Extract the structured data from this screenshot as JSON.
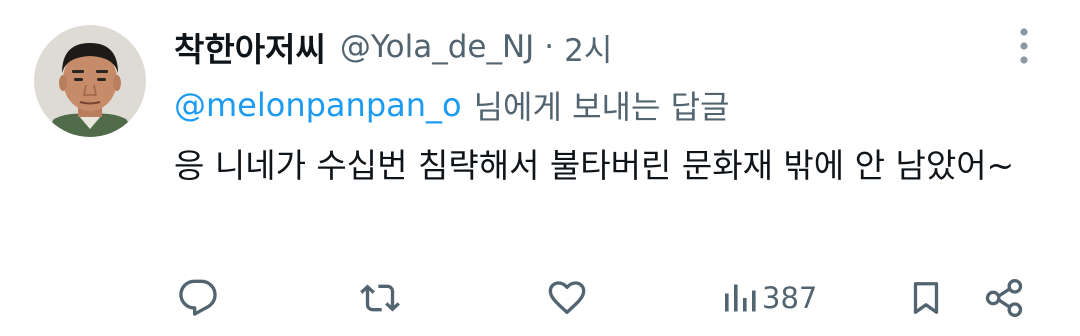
{
  "author": {
    "display_name": "착한아저씨",
    "handle": "@Yola_de_NJ",
    "separator": "·",
    "time": "2시"
  },
  "reply_context": {
    "mention": "@melonpanpan_o",
    "suffix": "님에게 보내는 답글"
  },
  "tweet": {
    "text": "응 니네가 수십번 침략해서 불타버린 문화재 밖에 안 남았어~"
  },
  "actions": {
    "views": "387"
  },
  "icons": {
    "more": "more-vertical-icon",
    "reply": "reply-icon",
    "retweet": "retweet-icon",
    "like": "heart-icon",
    "views": "views-chart-icon",
    "bookmark": "bookmark-icon",
    "share": "share-icon"
  },
  "colors": {
    "link": "#1d9bf0",
    "secondary_text": "#536471",
    "primary_text": "#0f1419"
  }
}
